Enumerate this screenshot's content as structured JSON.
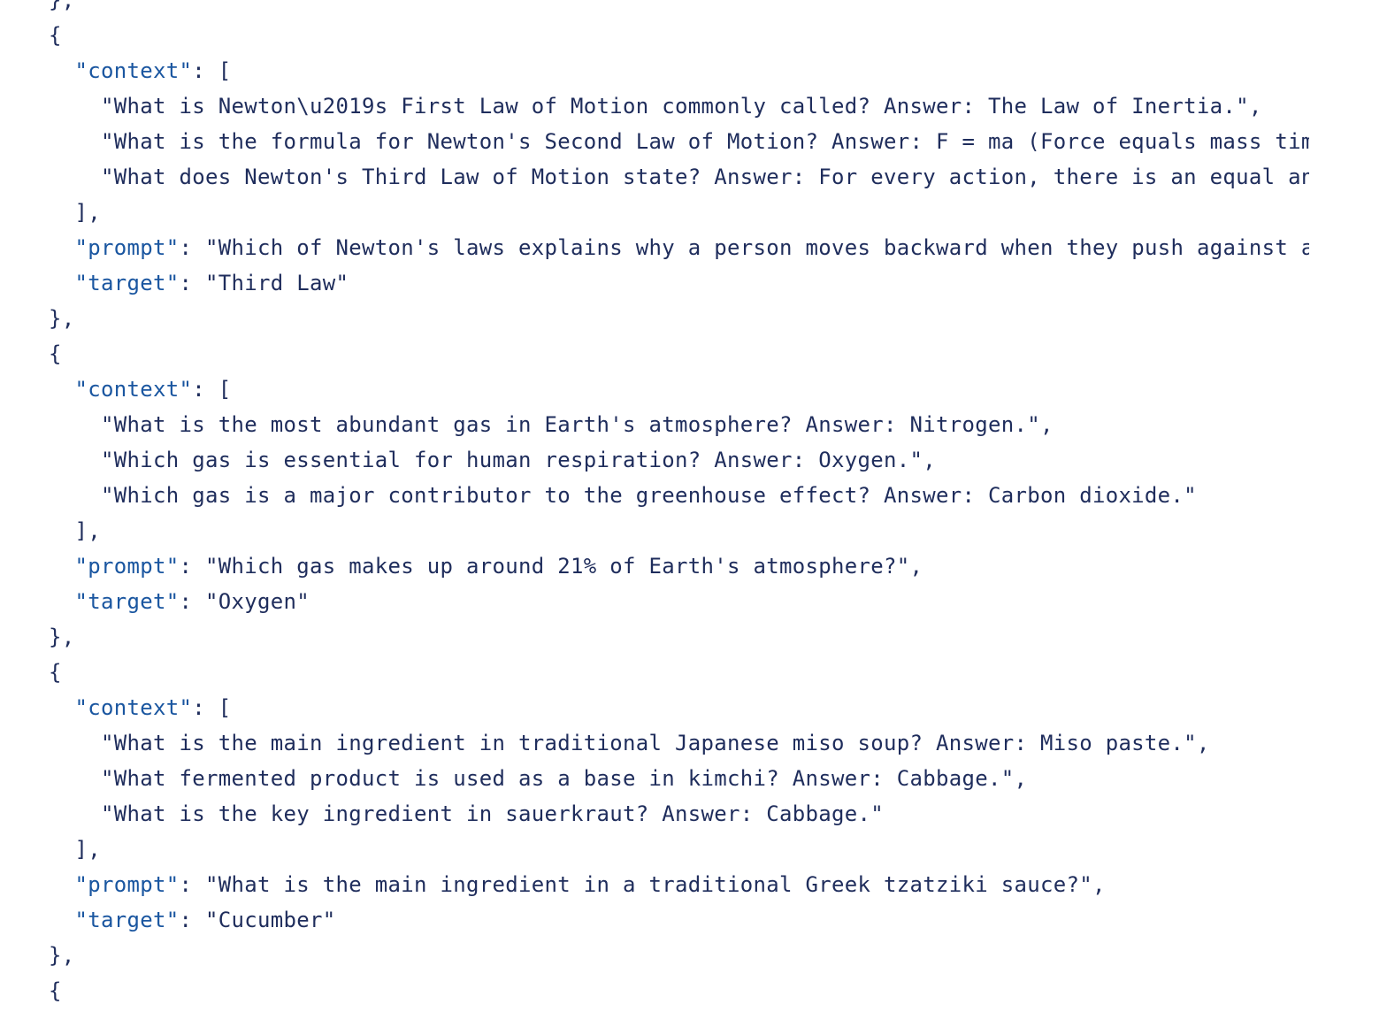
{
  "lines": [
    {
      "indent": "",
      "parts": [
        {
          "t": "punct",
          "v": "},"
        }
      ]
    },
    {
      "indent": "",
      "parts": [
        {
          "t": "punct",
          "v": "{"
        }
      ]
    },
    {
      "indent": "  ",
      "parts": [
        {
          "t": "key",
          "v": "\"context\""
        },
        {
          "t": "punct",
          "v": ": ["
        }
      ]
    },
    {
      "indent": "    ",
      "parts": [
        {
          "t": "str",
          "v": "\"What is Newton\\u2019s First Law of Motion commonly called? Answer: The Law of Inertia.\","
        }
      ]
    },
    {
      "indent": "    ",
      "parts": [
        {
          "t": "str",
          "v": "\"What is the formula for Newton's Second Law of Motion? Answer: F = ma (Force equals mass times"
        }
      ]
    },
    {
      "indent": "    ",
      "parts": [
        {
          "t": "str",
          "v": "\"What does Newton's Third Law of Motion state? Answer: For every action, there is an equal and"
        }
      ]
    },
    {
      "indent": "  ",
      "parts": [
        {
          "t": "punct",
          "v": "],"
        }
      ]
    },
    {
      "indent": "  ",
      "parts": [
        {
          "t": "key",
          "v": "\"prompt\""
        },
        {
          "t": "punct",
          "v": ": "
        },
        {
          "t": "str",
          "v": "\"Which of Newton's laws explains why a person moves backward when they push against a w"
        }
      ]
    },
    {
      "indent": "  ",
      "parts": [
        {
          "t": "key",
          "v": "\"target\""
        },
        {
          "t": "punct",
          "v": ": "
        },
        {
          "t": "str",
          "v": "\"Third Law\""
        }
      ]
    },
    {
      "indent": "",
      "parts": [
        {
          "t": "punct",
          "v": "},"
        }
      ]
    },
    {
      "indent": "",
      "parts": [
        {
          "t": "punct",
          "v": "{"
        }
      ]
    },
    {
      "indent": "  ",
      "parts": [
        {
          "t": "key",
          "v": "\"context\""
        },
        {
          "t": "punct",
          "v": ": ["
        }
      ]
    },
    {
      "indent": "    ",
      "parts": [
        {
          "t": "str",
          "v": "\"What is the most abundant gas in Earth's atmosphere? Answer: Nitrogen.\","
        }
      ]
    },
    {
      "indent": "    ",
      "parts": [
        {
          "t": "str",
          "v": "\"Which gas is essential for human respiration? Answer: Oxygen.\","
        }
      ]
    },
    {
      "indent": "    ",
      "parts": [
        {
          "t": "str",
          "v": "\"Which gas is a major contributor to the greenhouse effect? Answer: Carbon dioxide.\""
        }
      ]
    },
    {
      "indent": "  ",
      "parts": [
        {
          "t": "punct",
          "v": "],"
        }
      ]
    },
    {
      "indent": "  ",
      "parts": [
        {
          "t": "key",
          "v": "\"prompt\""
        },
        {
          "t": "punct",
          "v": ": "
        },
        {
          "t": "str",
          "v": "\"Which gas makes up around 21% of Earth's atmosphere?\","
        }
      ]
    },
    {
      "indent": "  ",
      "parts": [
        {
          "t": "key",
          "v": "\"target\""
        },
        {
          "t": "punct",
          "v": ": "
        },
        {
          "t": "str",
          "v": "\"Oxygen\""
        }
      ]
    },
    {
      "indent": "",
      "parts": [
        {
          "t": "punct",
          "v": "},"
        }
      ]
    },
    {
      "indent": "",
      "parts": [
        {
          "t": "punct",
          "v": "{"
        }
      ]
    },
    {
      "indent": "  ",
      "parts": [
        {
          "t": "key",
          "v": "\"context\""
        },
        {
          "t": "punct",
          "v": ": ["
        }
      ]
    },
    {
      "indent": "    ",
      "parts": [
        {
          "t": "str",
          "v": "\"What is the main ingredient in traditional Japanese miso soup? Answer: Miso paste.\","
        }
      ]
    },
    {
      "indent": "    ",
      "parts": [
        {
          "t": "str",
          "v": "\"What fermented product is used as a base in kimchi? Answer: Cabbage.\","
        }
      ]
    },
    {
      "indent": "    ",
      "parts": [
        {
          "t": "str",
          "v": "\"What is the key ingredient in sauerkraut? Answer: Cabbage.\""
        }
      ]
    },
    {
      "indent": "  ",
      "parts": [
        {
          "t": "punct",
          "v": "],"
        }
      ]
    },
    {
      "indent": "  ",
      "parts": [
        {
          "t": "key",
          "v": "\"prompt\""
        },
        {
          "t": "punct",
          "v": ": "
        },
        {
          "t": "str",
          "v": "\"What is the main ingredient in a traditional Greek tzatziki sauce?\","
        }
      ]
    },
    {
      "indent": "  ",
      "parts": [
        {
          "t": "key",
          "v": "\"target\""
        },
        {
          "t": "punct",
          "v": ": "
        },
        {
          "t": "str",
          "v": "\"Cucumber\""
        }
      ]
    },
    {
      "indent": "",
      "parts": [
        {
          "t": "punct",
          "v": "},"
        }
      ]
    },
    {
      "indent": "",
      "parts": [
        {
          "t": "punct",
          "v": "{"
        }
      ]
    }
  ],
  "colors": {
    "key": "#1a56a0",
    "text": "#1f2d5c",
    "background": "#ffffff"
  }
}
